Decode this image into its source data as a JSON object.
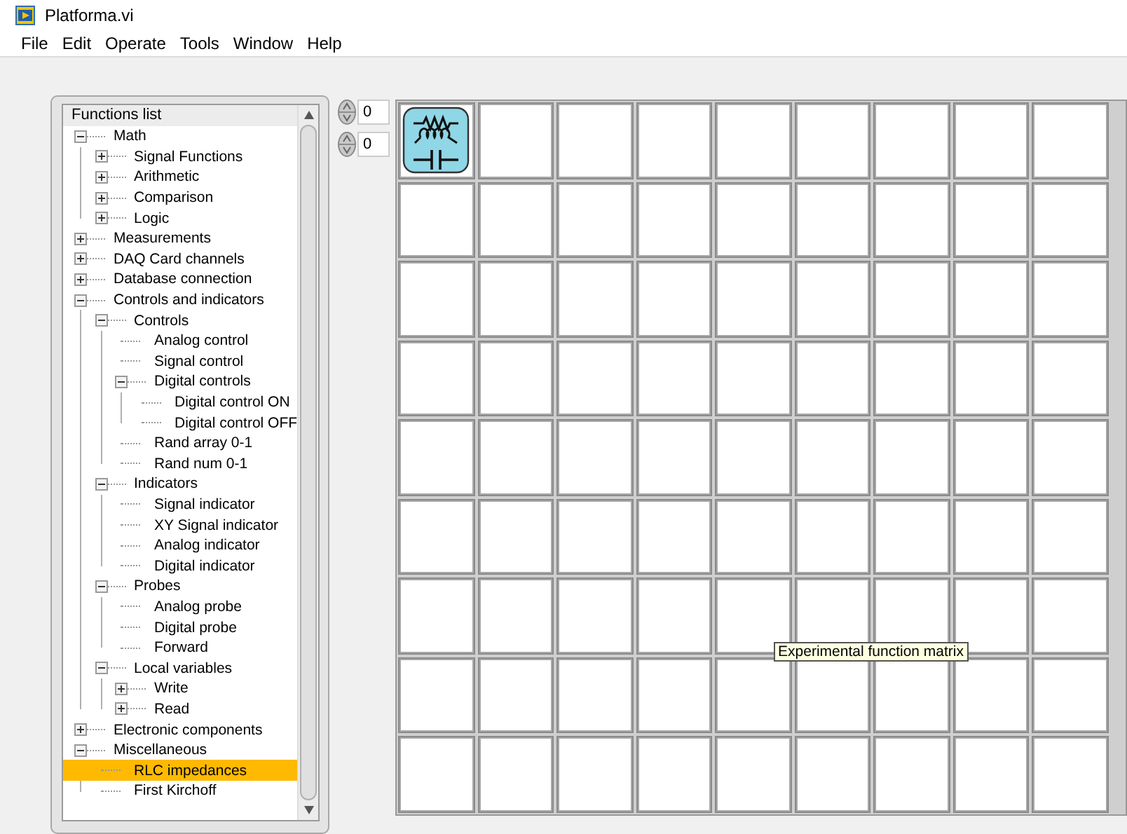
{
  "window": {
    "title": "Platforma.vi"
  },
  "menu": [
    "File",
    "Edit",
    "Operate",
    "Tools",
    "Window",
    "Help"
  ],
  "functions_list": {
    "title": "Functions list",
    "items": [
      {
        "label": "Math",
        "kind": "group",
        "expanded": true,
        "selected": false,
        "children": [
          {
            "label": "Signal Functions",
            "kind": "group",
            "expanded": false,
            "selected": false
          },
          {
            "label": "Arithmetic",
            "kind": "group",
            "expanded": false,
            "selected": false
          },
          {
            "label": "Comparison",
            "kind": "group",
            "expanded": false,
            "selected": false
          },
          {
            "label": "Logic",
            "kind": "group",
            "expanded": false,
            "selected": false
          }
        ]
      },
      {
        "label": "Measurements",
        "kind": "group",
        "expanded": false,
        "selected": false
      },
      {
        "label": "DAQ Card channels",
        "kind": "group",
        "expanded": false,
        "selected": false
      },
      {
        "label": "Database connection",
        "kind": "group",
        "expanded": false,
        "selected": false
      },
      {
        "label": "Controls and indicators",
        "kind": "group",
        "expanded": true,
        "selected": false,
        "children": [
          {
            "label": "Controls",
            "kind": "group",
            "expanded": true,
            "selected": false,
            "children": [
              {
                "label": "Analog control",
                "kind": "leaf",
                "selected": false
              },
              {
                "label": "Signal control",
                "kind": "leaf",
                "selected": false
              },
              {
                "label": "Digital controls",
                "kind": "group",
                "expanded": true,
                "selected": false,
                "children": [
                  {
                    "label": "Digital control ON",
                    "kind": "leaf",
                    "selected": false
                  },
                  {
                    "label": "Digital control OFF",
                    "kind": "leaf",
                    "selected": false
                  }
                ]
              },
              {
                "label": "Rand array 0-1",
                "kind": "leaf",
                "selected": false
              },
              {
                "label": "Rand num 0-1",
                "kind": "leaf",
                "selected": false
              }
            ]
          },
          {
            "label": "Indicators",
            "kind": "group",
            "expanded": true,
            "selected": false,
            "children": [
              {
                "label": "Signal indicator",
                "kind": "leaf",
                "selected": false
              },
              {
                "label": "XY Signal indicator",
                "kind": "leaf",
                "selected": false
              },
              {
                "label": "Analog indicator",
                "kind": "leaf",
                "selected": false
              },
              {
                "label": "Digital indicator",
                "kind": "leaf",
                "selected": false
              }
            ]
          },
          {
            "label": "Probes",
            "kind": "group",
            "expanded": true,
            "selected": false,
            "children": [
              {
                "label": "Analog probe",
                "kind": "leaf",
                "selected": false
              },
              {
                "label": "Digital probe",
                "kind": "leaf",
                "selected": false
              },
              {
                "label": "Forward",
                "kind": "leaf",
                "selected": false
              }
            ]
          },
          {
            "label": "Local variables",
            "kind": "group",
            "expanded": true,
            "selected": false,
            "children": [
              {
                "label": "Write",
                "kind": "group",
                "expanded": false,
                "selected": false
              },
              {
                "label": "Read",
                "kind": "group",
                "expanded": false,
                "selected": false
              }
            ]
          }
        ]
      },
      {
        "label": "Electronic components",
        "kind": "group",
        "expanded": false,
        "selected": false
      },
      {
        "label": "Miscellaneous",
        "kind": "group",
        "expanded": true,
        "selected": false,
        "children": [
          {
            "label": "RLC impedances",
            "kind": "leaf",
            "selected": true
          },
          {
            "label": "First Kirchoff",
            "kind": "leaf",
            "selected": false
          }
        ]
      }
    ]
  },
  "indices": [
    "0",
    "0"
  ],
  "matrix": {
    "tooltip": "Experimental function matrix",
    "rows": [
      {
        "cells": [
          {
            "kind": "rlc"
          },
          {
            "kind": "empty"
          },
          {
            "kind": "empty"
          },
          {
            "kind": "empty"
          },
          {
            "kind": "empty"
          },
          {
            "kind": "empty"
          },
          {
            "kind": "empty"
          },
          {
            "kind": "empty"
          },
          {
            "kind": "empty"
          }
        ]
      },
      {
        "cells": [
          {
            "kind": "empty"
          },
          {
            "kind": "empty"
          },
          {
            "kind": "empty"
          },
          {
            "kind": "empty"
          },
          {
            "kind": "empty"
          },
          {
            "kind": "empty"
          },
          {
            "kind": "empty"
          },
          {
            "kind": "empty"
          },
          {
            "kind": "empty"
          }
        ]
      },
      {
        "cells": [
          {
            "kind": "empty"
          },
          {
            "kind": "empty"
          },
          {
            "kind": "empty"
          },
          {
            "kind": "empty"
          },
          {
            "kind": "empty"
          },
          {
            "kind": "empty"
          },
          {
            "kind": "empty"
          },
          {
            "kind": "empty"
          },
          {
            "kind": "empty"
          }
        ]
      },
      {
        "cells": [
          {
            "kind": "empty"
          },
          {
            "kind": "empty"
          },
          {
            "kind": "empty"
          },
          {
            "kind": "empty"
          },
          {
            "kind": "empty"
          },
          {
            "kind": "empty"
          },
          {
            "kind": "empty"
          },
          {
            "kind": "empty"
          },
          {
            "kind": "empty"
          }
        ]
      },
      {
        "cells": [
          {
            "kind": "empty"
          },
          {
            "kind": "empty"
          },
          {
            "kind": "empty"
          },
          {
            "kind": "empty"
          },
          {
            "kind": "empty"
          },
          {
            "kind": "empty"
          },
          {
            "kind": "empty"
          },
          {
            "kind": "empty"
          },
          {
            "kind": "empty"
          }
        ]
      },
      {
        "cells": [
          {
            "kind": "empty"
          },
          {
            "kind": "empty"
          },
          {
            "kind": "empty"
          },
          {
            "kind": "empty"
          },
          {
            "kind": "empty"
          },
          {
            "kind": "empty"
          },
          {
            "kind": "empty"
          },
          {
            "kind": "empty"
          },
          {
            "kind": "empty"
          }
        ]
      },
      {
        "cells": [
          {
            "kind": "empty"
          },
          {
            "kind": "empty"
          },
          {
            "kind": "empty"
          },
          {
            "kind": "empty"
          },
          {
            "kind": "empty"
          },
          {
            "kind": "empty"
          },
          {
            "kind": "empty"
          },
          {
            "kind": "empty"
          },
          {
            "kind": "empty"
          }
        ]
      },
      {
        "cells": [
          {
            "kind": "empty"
          },
          {
            "kind": "empty"
          },
          {
            "kind": "empty"
          },
          {
            "kind": "empty"
          },
          {
            "kind": "empty"
          },
          {
            "kind": "empty"
          },
          {
            "kind": "empty"
          },
          {
            "kind": "empty"
          },
          {
            "kind": "empty"
          }
        ]
      },
      {
        "cells": [
          {
            "kind": "empty"
          },
          {
            "kind": "empty"
          },
          {
            "kind": "empty"
          },
          {
            "kind": "empty"
          },
          {
            "kind": "empty"
          },
          {
            "kind": "empty"
          },
          {
            "kind": "empty"
          },
          {
            "kind": "empty"
          },
          {
            "kind": "empty"
          }
        ]
      }
    ]
  }
}
